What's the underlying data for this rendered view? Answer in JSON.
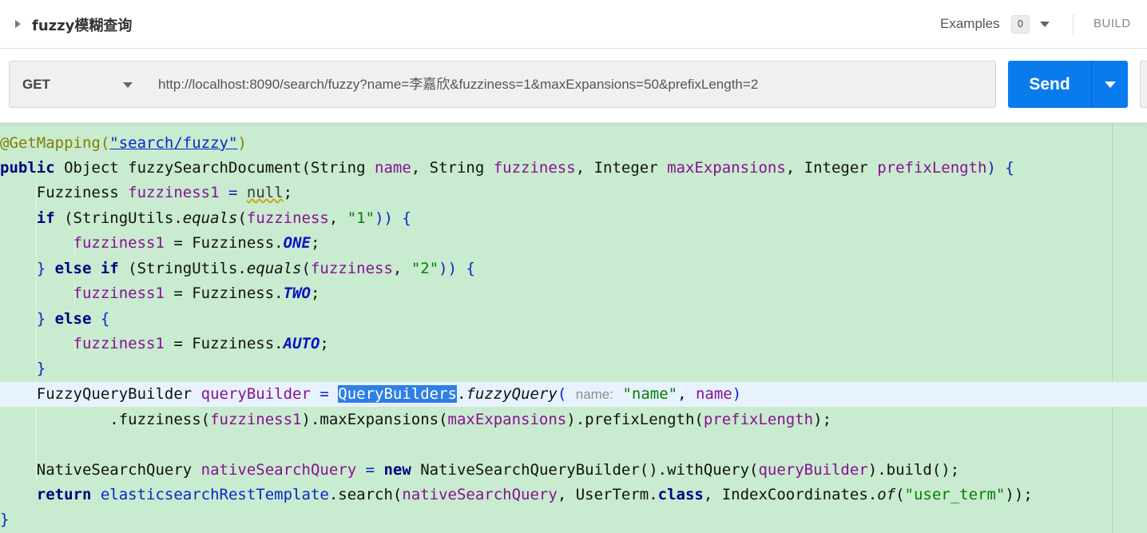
{
  "header": {
    "title": "fuzzy模糊查询",
    "examples_label": "Examples",
    "examples_count": "0",
    "build_label": "BUILD"
  },
  "request": {
    "method": "GET",
    "url": "http://localhost:8090/search/fuzzy?name=李嘉欣&fuzziness=1&maxExpansions=50&prefixLength=2",
    "send_label": "Send"
  },
  "code": {
    "l1_ann": "@GetMapping(",
    "l1_str": "\"search/fuzzy\"",
    "l1_end": ")",
    "l2_kw": "public ",
    "l2_a": "Object fuzzySearchDocument(String ",
    "l2_p1": "name",
    "l2_b": ", String ",
    "l2_p2": "fuzziness",
    "l2_c": ", Integer ",
    "l2_p3": "maxExpansions",
    "l2_d": ", Integer ",
    "l2_p4": "prefixLength",
    "l2_e": ") {",
    "l3_a": "    Fuzziness ",
    "l3_var": "fuzziness1",
    "l3_b": " = ",
    "l3_null": "null",
    "l3_c": ";",
    "l4_kw": "    if ",
    "l4_a": "(StringUtils.",
    "l4_m": "equals",
    "l4_b": "(",
    "l4_p": "fuzziness",
    "l4_c": ", ",
    "l4_s": "\"1\"",
    "l4_d": ")) {",
    "l5_var": "        fuzziness1",
    "l5_a": " = Fuzziness.",
    "l5_const": "ONE",
    "l5_b": ";",
    "l6_a": "    } ",
    "l6_kw": "else if ",
    "l6_b": "(StringUtils.",
    "l6_m": "equals",
    "l6_c": "(",
    "l6_p": "fuzziness",
    "l6_d": ", ",
    "l6_s": "\"2\"",
    "l6_e": ")) {",
    "l7_var": "        fuzziness1",
    "l7_a": " = Fuzziness.",
    "l7_const": "TWO",
    "l7_b": ";",
    "l8_a": "    } ",
    "l8_kw": "else ",
    "l8_b": "{",
    "l9_var": "        fuzziness1",
    "l9_a": " = Fuzziness.",
    "l9_const": "AUTO",
    "l9_b": ";",
    "l10": "    }",
    "l11_a": "    FuzzyQueryBuilder ",
    "l11_var": "queryBuilder",
    "l11_b": " = ",
    "l11_sel": "QueryBuilders",
    "l11_c": ".",
    "l11_m": "fuzzyQuery",
    "l11_d": "( ",
    "l11_hint": "name:",
    "l11_e": " ",
    "l11_s": "\"name\"",
    "l11_f": ", ",
    "l11_p": "name",
    "l11_g": ")",
    "l12_a": "            .fuzziness(",
    "l12_v": "fuzziness1",
    "l12_b": ").maxExpansions(",
    "l12_p1": "maxExpansions",
    "l12_c": ").prefixLength(",
    "l12_p2": "prefixLength",
    "l12_d": ");",
    "l14_a": "    NativeSearchQuery ",
    "l14_var": "nativeSearchQuery",
    "l14_b": " = ",
    "l14_kw": "new ",
    "l14_c": "NativeSearchQueryBuilder().withQuery(",
    "l14_v": "queryBuilder",
    "l14_d": ").build();",
    "l15_kw": "    return ",
    "l15_f": "elasticsearchRestTemplate",
    "l15_a": ".search(",
    "l15_v": "nativeSearchQuery",
    "l15_b": ", UserTerm.",
    "l15_kw2": "class",
    "l15_c": ", IndexCoordinates.",
    "l15_m": "of",
    "l15_d": "(",
    "l15_s": "\"user_term\"",
    "l15_e": "));",
    "l16": "}"
  }
}
